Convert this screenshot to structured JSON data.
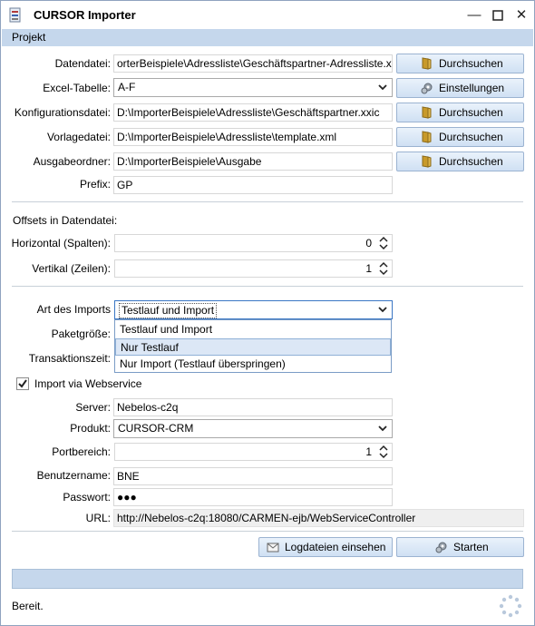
{
  "window": {
    "title": "CURSOR Importer"
  },
  "menu": {
    "items": [
      "Projekt"
    ]
  },
  "form": {
    "datendatei": {
      "label": "Datendatei:",
      "value": "orterBeispiele\\Adressliste\\Geschäftspartner-Adressliste.xlsx",
      "button": "Durchsuchen"
    },
    "excel_tabelle": {
      "label": "Excel-Tabelle:",
      "value": "A-F",
      "button": "Einstellungen"
    },
    "konfigurationsdatei": {
      "label": "Konfigurationsdatei:",
      "value": "D:\\ImporterBeispiele\\Adressliste\\Geschäftspartner.xxic",
      "button": "Durchsuchen"
    },
    "vorlagedatei": {
      "label": "Vorlagedatei:",
      "value": "D:\\ImporterBeispiele\\Adressliste\\template.xml",
      "button": "Durchsuchen"
    },
    "ausgabeordner": {
      "label": "Ausgabeordner:",
      "value": "D:\\ImporterBeispiele\\Ausgabe",
      "button": "Durchsuchen"
    },
    "prefix": {
      "label": "Prefix:",
      "value": "GP"
    }
  },
  "offsets": {
    "heading": "Offsets in Datendatei:",
    "horizontal": {
      "label": "Horizontal (Spalten):",
      "value": "0"
    },
    "vertikal": {
      "label": "Vertikal (Zeilen):",
      "value": "1"
    }
  },
  "import": {
    "art_label": "Art des Imports",
    "art_value": "Testlauf und Import",
    "options": [
      "Testlauf und Import",
      "Nur Testlauf",
      "Nur Import (Testlauf überspringen)"
    ],
    "highlighted_option": 1,
    "paketgroesse_label": "Paketgröße:",
    "transaktionszeit_label": "Transaktionszeit:"
  },
  "webservice": {
    "checkbox_label": "Import via Webservice",
    "checked": true,
    "server": {
      "label": "Server:",
      "value": "Nebelos-c2q"
    },
    "produkt": {
      "label": "Produkt:",
      "value": "CURSOR-CRM"
    },
    "portbereich": {
      "label": "Portbereich:",
      "value": "1"
    },
    "benutzername": {
      "label": "Benutzername:",
      "value": "BNE"
    },
    "passwort": {
      "label": "Passwort:",
      "value": "●●●"
    },
    "url": {
      "label": "URL:",
      "value": "http://Nebelos-c2q:18080/CARMEN-ejb/WebServiceController"
    }
  },
  "actions": {
    "log_button": "Logdateien einsehen",
    "start_button": "Starten"
  },
  "status": {
    "text": "Bereit."
  },
  "colors": {
    "menubar": "#c5d7ec",
    "button_border": "#9bb3d1",
    "dropdown_highlight": "#dce7f6"
  }
}
